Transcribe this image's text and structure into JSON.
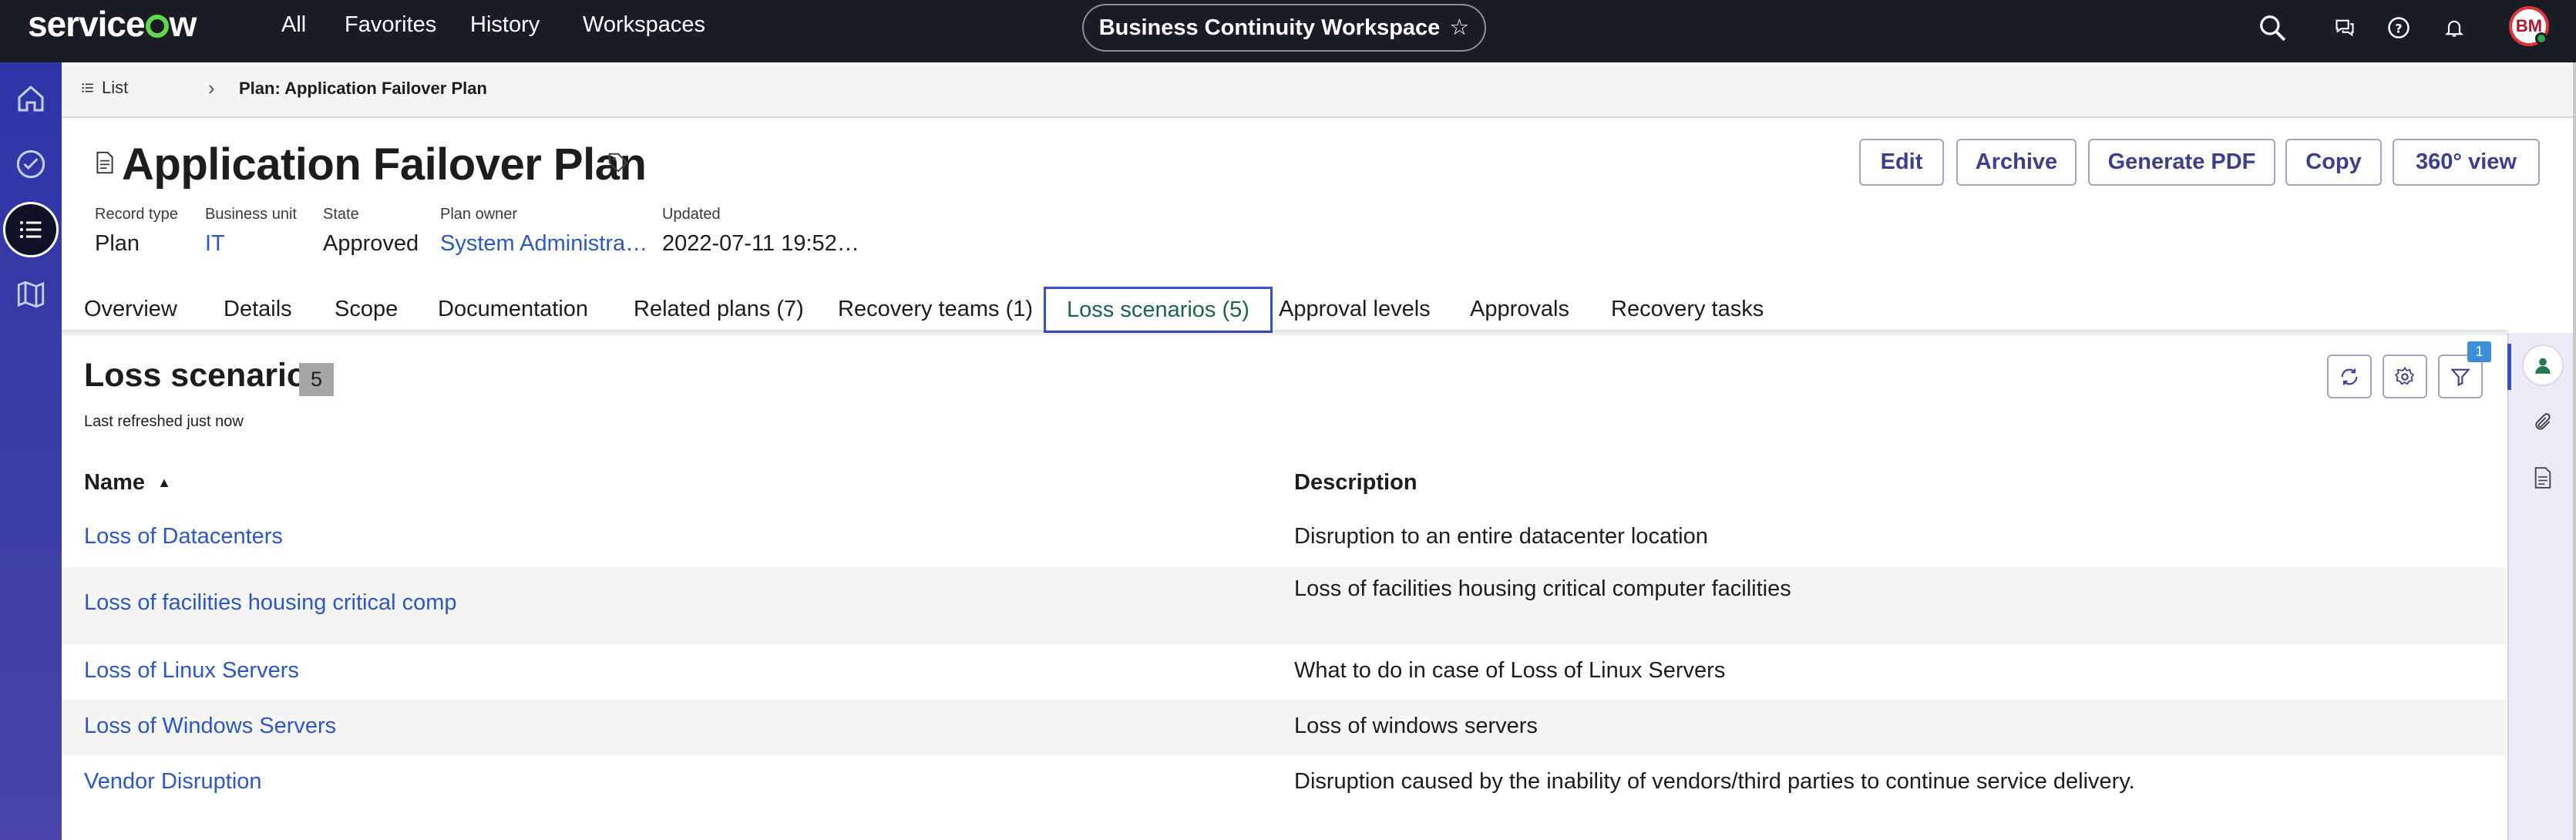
{
  "topbar": {
    "logo": "servicenow",
    "nav": [
      "All",
      "Favorites",
      "History",
      "Workspaces"
    ],
    "workspace_title": "Business Continuity Workspace",
    "avatar_initials": "BM",
    "icons": [
      "search-icon",
      "chat-icon",
      "help-icon",
      "bell-icon"
    ]
  },
  "left_rail": {
    "icons": [
      "home-icon",
      "check-circle-icon",
      "list-icon",
      "map-icon"
    ],
    "active": "list-icon"
  },
  "breadcrumb": {
    "list_label": "List",
    "current": "Plan: Application Failover Plan"
  },
  "record": {
    "title": "Application Failover Plan",
    "meta": [
      {
        "label": "Record type",
        "value": "Plan",
        "link": false
      },
      {
        "label": "Business unit",
        "value": "IT",
        "link": true
      },
      {
        "label": "State",
        "value": "Approved",
        "link": false
      },
      {
        "label": "Plan owner",
        "value": "System Administra…",
        "link": true
      },
      {
        "label": "Updated",
        "value": "2022-07-11 19:52…",
        "link": false
      }
    ],
    "actions": [
      "Edit",
      "Archive",
      "Generate PDF",
      "Copy",
      "360° view"
    ]
  },
  "tabs": [
    "Overview",
    "Details",
    "Scope",
    "Documentation",
    "Related plans (7)",
    "Recovery teams (1)",
    "Loss scenarios (5)",
    "Approval levels",
    "Approvals",
    "Recovery tasks"
  ],
  "active_tab": "Loss scenarios (5)",
  "section": {
    "title": "Loss scenarios",
    "count": "5",
    "refreshed": "Last refreshed just now",
    "filter_count": "1"
  },
  "table": {
    "columns": [
      "Name",
      "Description"
    ],
    "sort_indicator": "▲",
    "rows": [
      {
        "name": "Loss of Datacenters",
        "description": "Disruption to an entire datacenter location"
      },
      {
        "name": "Loss of facilities housing critical comp",
        "description": "Loss of facilities housing critical computer facilities"
      },
      {
        "name": "Loss of Linux Servers",
        "description": "What to do in case of Loss of Linux Servers"
      },
      {
        "name": "Loss of Windows Servers",
        "description": "Loss of windows servers"
      },
      {
        "name": "Vendor Disruption",
        "description": "Disruption caused by the inability of vendors/third parties to continue service delivery."
      }
    ]
  },
  "colors": {
    "topbar": "#1a1d26",
    "rail": "#2d35a8",
    "link": "#2d57c7",
    "accent": "#3b50c7",
    "active_tab_text": "#1f6153"
  }
}
